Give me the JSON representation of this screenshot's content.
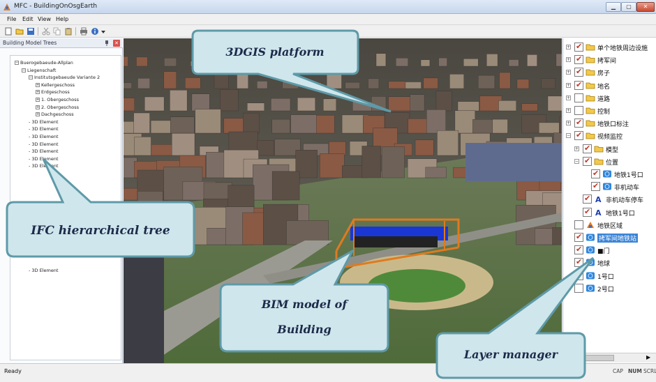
{
  "window": {
    "title": "MFC - BuildingOnOsgEarth"
  },
  "menu": [
    "File",
    "Edit",
    "View",
    "Help"
  ],
  "toolbar_icons": [
    "new-file-icon",
    "open-folder-icon",
    "save-icon",
    "cut-icon",
    "copy-icon",
    "paste-icon",
    "print-icon",
    "about-icon",
    "dropdown-icon"
  ],
  "left_panel": {
    "title": "Building Model Trees",
    "tree": [
      {
        "label": "Buerogebaeude-Allplan",
        "depth": 0,
        "exp": "−"
      },
      {
        "label": "Liegenschaft",
        "depth": 1,
        "exp": "−"
      },
      {
        "label": "Institutsgebaeude Variante 2",
        "depth": 2,
        "exp": "−"
      },
      {
        "label": "Kellergeschoss",
        "depth": 3,
        "exp": "+"
      },
      {
        "label": "Erdgeschoss",
        "depth": 3,
        "exp": "+"
      },
      {
        "label": "1. Obergeschoss",
        "depth": 3,
        "exp": "+"
      },
      {
        "label": "2. Obergeschoss",
        "depth": 3,
        "exp": "+"
      },
      {
        "label": "Dachgeschoss",
        "depth": 3,
        "exp": "+"
      },
      {
        "label": "3D Element",
        "depth": 2
      },
      {
        "label": "3D Element",
        "depth": 2
      },
      {
        "label": "3D Element",
        "depth": 2
      },
      {
        "label": "3D Element",
        "depth": 2
      },
      {
        "label": "3D Element",
        "depth": 2
      },
      {
        "label": "3D Element",
        "depth": 2
      },
      {
        "label": "3D Element",
        "depth": 2
      }
    ],
    "bottom_item": "3D Element"
  },
  "layers": [
    {
      "label": "单个地铁周边设施",
      "depth": 0,
      "exp": "+",
      "checked": true,
      "icon": "folder-icon"
    },
    {
      "label": "拷军间",
      "depth": 0,
      "exp": "+",
      "checked": true,
      "icon": "folder-icon"
    },
    {
      "label": "房子",
      "depth": 0,
      "exp": "+",
      "checked": true,
      "icon": "folder-icon"
    },
    {
      "label": "地名",
      "depth": 0,
      "exp": "+",
      "checked": true,
      "icon": "folder-icon"
    },
    {
      "label": "道路",
      "depth": 0,
      "exp": "+",
      "checked": false,
      "icon": "folder-icon"
    },
    {
      "label": "控制",
      "depth": 0,
      "exp": "+",
      "checked": false,
      "icon": "folder-icon"
    },
    {
      "label": "地铁口标注",
      "depth": 0,
      "exp": "+",
      "checked": true,
      "icon": "folder-icon"
    },
    {
      "label": "视频监控",
      "depth": 0,
      "exp": "−",
      "checked": true,
      "icon": "folder-icon"
    },
    {
      "label": "模型",
      "depth": 1,
      "exp": "+",
      "checked": true,
      "icon": "folder-icon"
    },
    {
      "label": "位置",
      "depth": 1,
      "exp": "−",
      "checked": true,
      "icon": "folder-icon"
    },
    {
      "label": "地铁1号口",
      "depth": 2,
      "checked": true,
      "icon": "globe-icon"
    },
    {
      "label": "非机动车",
      "depth": 2,
      "checked": true,
      "icon": "globe-icon"
    },
    {
      "label": "非机动车停车",
      "depth": 1,
      "checked": true,
      "icon": "annotation-icon"
    },
    {
      "label": "地铁1号口",
      "depth": 1,
      "checked": true,
      "icon": "annotation-icon"
    },
    {
      "label": "地铁区域",
      "depth": 0,
      "checked": false,
      "icon": "region-icon"
    },
    {
      "label": "拷军间地铁站",
      "depth": 0,
      "checked": true,
      "icon": "globe-icon",
      "selected": true
    },
    {
      "label": "■门",
      "depth": 0,
      "checked": true,
      "icon": "globe-icon"
    },
    {
      "label": "地球",
      "depth": 0,
      "checked": true,
      "icon": "globe-icon"
    },
    {
      "label": "1号口",
      "depth": 0,
      "checked": false,
      "icon": "globe-icon"
    },
    {
      "label": "2号口",
      "depth": 0,
      "checked": false,
      "icon": "globe-icon"
    }
  ],
  "status": {
    "ready": "Ready",
    "indicators": [
      "CAP",
      "NUM",
      "SCRL"
    ]
  },
  "callouts": {
    "gis": "3DGIS platform",
    "ifc": "IFC hierarchical tree",
    "bim_line1": "BIM model of",
    "bim_line2": "Building",
    "layer": "Layer manager"
  },
  "colors": {
    "callout_fill": "#cfe6ec",
    "callout_stroke": "#5e9aa8",
    "selection": "#3b84d6",
    "check": "#c0392b"
  }
}
